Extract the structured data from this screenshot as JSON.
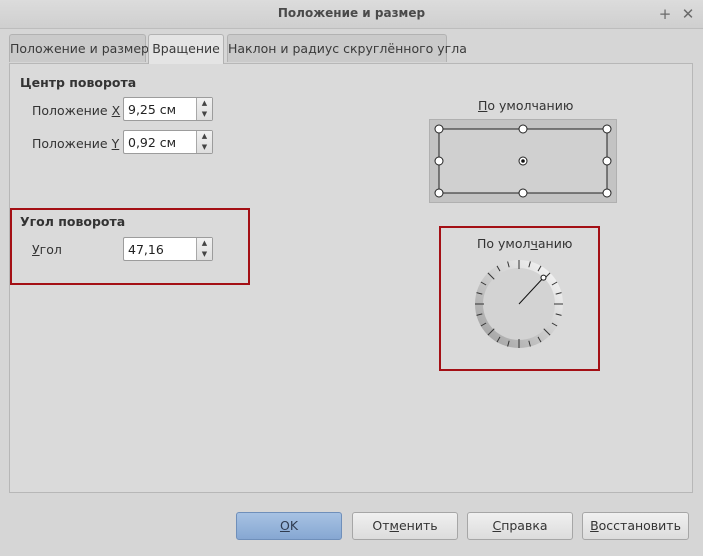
{
  "window": {
    "title": "Положение и размер",
    "pin_glyph": "+",
    "close_glyph": "✕"
  },
  "tabs": [
    {
      "label": "Положение и размер"
    },
    {
      "label": "Вращение"
    },
    {
      "label": "Наклон и радиус скруглённого угла"
    }
  ],
  "pivot": {
    "heading": "Центр поворота",
    "x_label": "Положение ",
    "x_key": "X",
    "x_value": "9,25 см",
    "y_label": "Положение ",
    "y_key": "Y",
    "y_value": "0,92 см",
    "default_pre": "",
    "default_key": "П",
    "default_post": "о умолчанию"
  },
  "rotation": {
    "heading": "Угол поворота",
    "angle_key": "У",
    "angle_post": "гол",
    "angle_value": "47,16",
    "default_pre": "По умол",
    "default_key": "ч",
    "default_post": "анию",
    "angle_degrees": 47.16
  },
  "buttons": {
    "ok_key": "О",
    "ok_post": "K",
    "cancel_pre": "От",
    "cancel_key": "м",
    "cancel_post": "енить",
    "help_key": "С",
    "help_post": "правка",
    "reset_pre": "",
    "reset_key": "В",
    "reset_post": "осстановить"
  },
  "colors": {
    "highlight_border": "#a40f15",
    "default_button": "#8eaed6"
  }
}
